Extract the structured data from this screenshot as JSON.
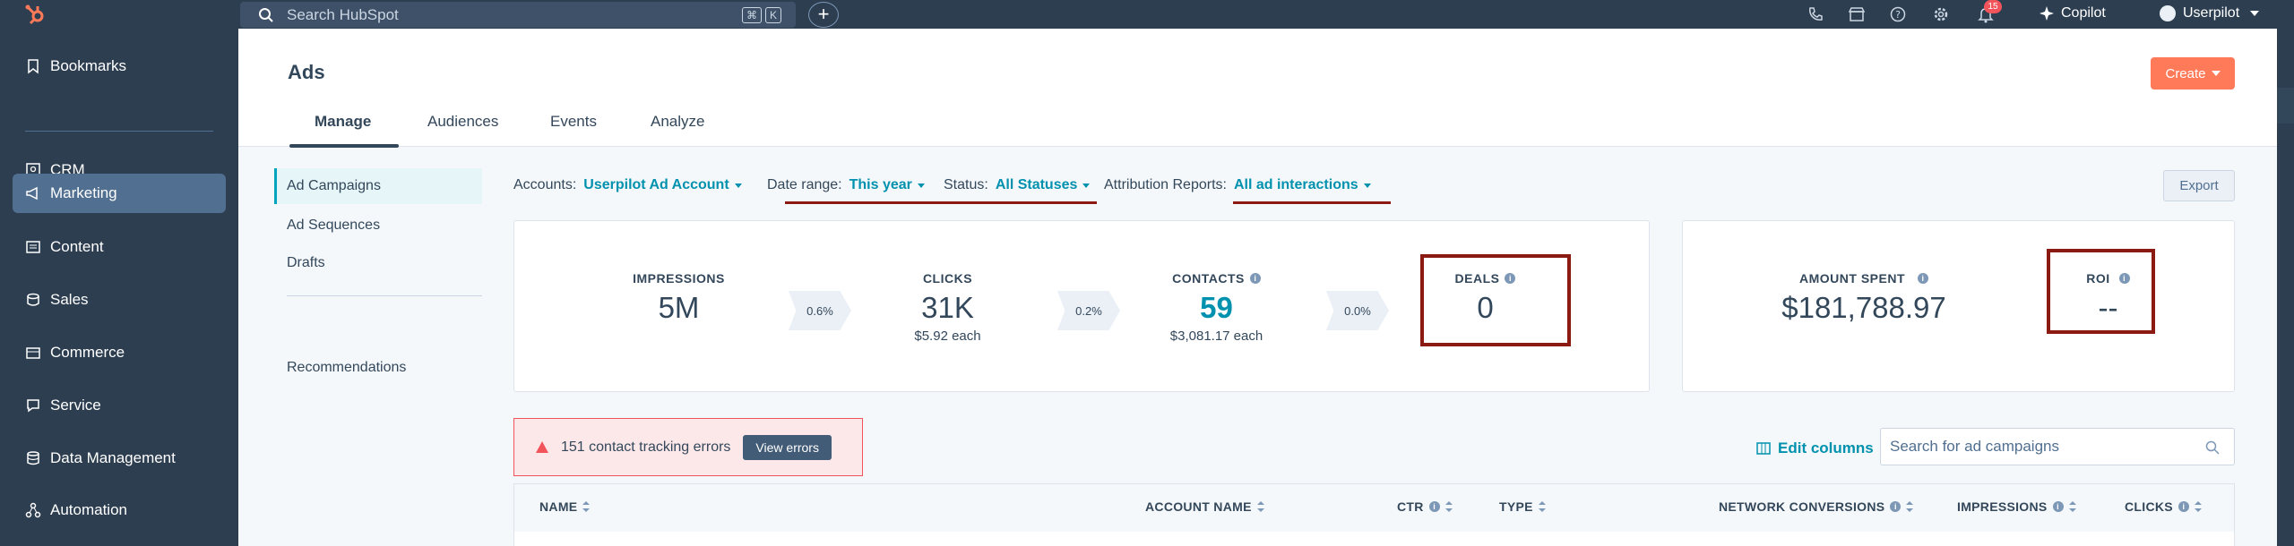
{
  "topbar": {
    "search_placeholder": "Search HubSpot",
    "shortcut_keys": [
      "⌘",
      "K"
    ],
    "plus_label": "+",
    "notification_count": "15",
    "copilot_label": "Copilot",
    "user_label": "Userpilot",
    "icons": [
      "logo-icon",
      "search-icon",
      "phone-icon",
      "marketplace-icon",
      "help-icon",
      "settings-icon",
      "bell-icon",
      "sparkle-icon",
      "avatar"
    ]
  },
  "sidebar": {
    "items": [
      {
        "label": "Bookmarks",
        "icon": "bookmark-icon"
      },
      {
        "label": "CRM",
        "icon": "crm-icon"
      },
      {
        "label": "Marketing",
        "icon": "megaphone-icon",
        "active": true
      },
      {
        "label": "Content",
        "icon": "content-icon"
      },
      {
        "label": "Sales",
        "icon": "sales-icon"
      },
      {
        "label": "Commerce",
        "icon": "commerce-icon"
      },
      {
        "label": "Service",
        "icon": "service-icon"
      },
      {
        "label": "Data Management",
        "icon": "database-icon"
      },
      {
        "label": "Automation",
        "icon": "automation-icon"
      }
    ]
  },
  "header": {
    "title": "Ads",
    "create_label": "Create",
    "tabs": [
      {
        "label": "Manage",
        "active": true
      },
      {
        "label": "Audiences"
      },
      {
        "label": "Events"
      },
      {
        "label": "Analyze"
      }
    ]
  },
  "subnav": {
    "items": [
      "Ad Campaigns",
      "Ad Sequences",
      "Drafts"
    ],
    "recommendations": "Recommendations"
  },
  "filters": {
    "accounts_label": "Accounts:",
    "accounts_value": "Userpilot Ad Account",
    "date_label": "Date range:",
    "date_value": "This year",
    "status_label": "Status:",
    "status_value": "All Statuses",
    "attribution_label": "Attribution Reports:",
    "attribution_value": "All ad interactions",
    "export_label": "Export"
  },
  "metrics": {
    "impressions": {
      "label": "IMPRESSIONS",
      "value": "5M"
    },
    "rate1": "0.6%",
    "clicks": {
      "label": "CLICKS",
      "value": "31K",
      "sub": "$5.92 each"
    },
    "rate2": "0.2%",
    "contacts": {
      "label": "CONTACTS",
      "value": "59",
      "sub": "$3,081.17 each"
    },
    "rate3": "0.0%",
    "deals": {
      "label": "DEALS",
      "value": "0"
    },
    "amount_spent": {
      "label": "AMOUNT SPENT",
      "value": "$181,788.97"
    },
    "roi": {
      "label": "ROI",
      "value": "--"
    }
  },
  "errors": {
    "text": "151 contact tracking errors",
    "button": "View errors"
  },
  "table": {
    "edit_columns": "Edit columns",
    "search_placeholder": "Search for ad campaigns",
    "columns": [
      "NAME",
      "ACCOUNT NAME",
      "CTR",
      "TYPE",
      "NETWORK CONVERSIONS",
      "IMPRESSIONS",
      "CLICKS"
    ]
  },
  "colors": {
    "nav_bg": "#2d3e50",
    "accent_orange": "#ff7a59",
    "teal": "#0091ae",
    "annotation_red": "#8b1a12"
  }
}
